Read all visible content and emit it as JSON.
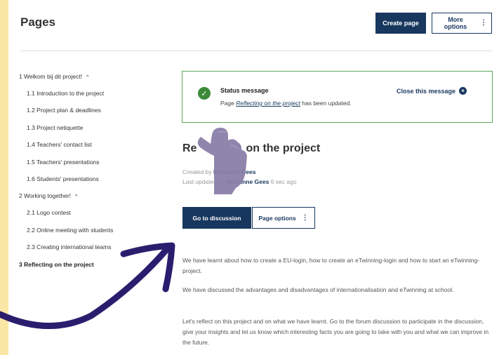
{
  "header": {
    "title": "Pages",
    "create_label": "Create page",
    "more_label": "More options"
  },
  "sidebar": {
    "items": [
      {
        "label": "1  Welkom bij dit project!",
        "caret": "^"
      },
      {
        "label": "1.1  Introduction to the project"
      },
      {
        "label": "1.2  Project plan & deadlines"
      },
      {
        "label": "1.3  Project netiquette"
      },
      {
        "label": "1.4  Teachers' contact list"
      },
      {
        "label": "1.5  Teachers' presentations"
      },
      {
        "label": "1.6  Students' presentations"
      },
      {
        "label": "2  Working together!",
        "caret": "^"
      },
      {
        "label": "2.1  Logo contest"
      },
      {
        "label": "2.2  Online meeting with students"
      },
      {
        "label": "2.3  Creating international teams"
      },
      {
        "label": "3  Reflecting on the project"
      }
    ]
  },
  "status": {
    "title": "Status message",
    "text_prefix": "Page ",
    "link": "Reflecting on the project",
    "text_suffix": " has been updated.",
    "close_label": "Close this message"
  },
  "main": {
    "heading_start": "Re",
    "heading_end": "on the project",
    "created_prefix": "Created by ",
    "created_by": "Marianne Gees",
    "updated_prefix": "Last updated by ",
    "updated_by": "Marianne Gees",
    "updated_time": " 6 sec ago",
    "discussion_label": "Go to discussion",
    "page_options_label": "Page options",
    "paragraphs": [
      "We have learnt about how to create a EU-login, how to create an eTwinning-login and how to start an eTwinning-project.",
      "We have discussed the advantages and disadvantages of internationalisation and eTwinning at school.",
      "Let's reflect on this project and on what we have learnt. Go to the forum discussion to participate in the discussion, give your insights and let us know which interesting facts you are going to take with you and what we can improve in the future."
    ]
  },
  "colors": {
    "background": "#fbe7a5",
    "primary": "#17375e",
    "success": "#3c8a3a",
    "arrow": "#2b1d6e",
    "hand": "#8a7ea8"
  }
}
